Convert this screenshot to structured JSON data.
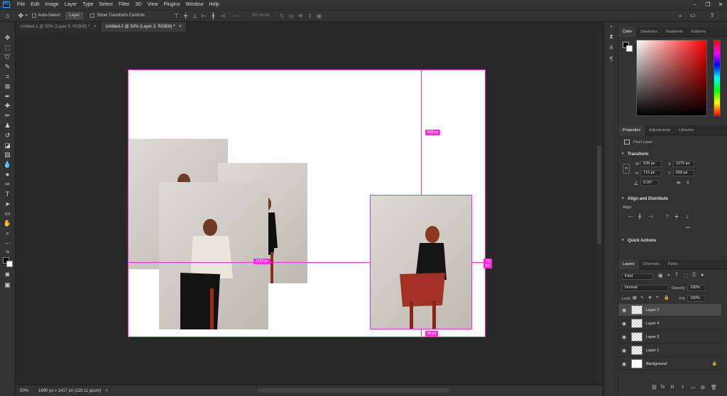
{
  "menubar": {
    "app_icon": "Ps",
    "items": [
      "File",
      "Edit",
      "Image",
      "Layer",
      "Type",
      "Select",
      "Filter",
      "3D",
      "View",
      "Plugins",
      "Window",
      "Help"
    ]
  },
  "options": {
    "auto_select_label": "Auto-Select:",
    "auto_select_value": "Layer",
    "show_transform_label": "Show Transform Controls",
    "mode_label": "3D Mode:"
  },
  "tabs": [
    {
      "label": "Untitled-1 @ 50% (Layer 5, RGB/8) *",
      "close": "×"
    },
    {
      "label": "Untitled-2 @ 50% (Layer 2, RGB/8) *",
      "close": "×"
    }
  ],
  "canvas": {
    "measure_top": "658 px",
    "measure_left": "1275 px",
    "measure_right": "70 px",
    "measure_bottom": "46 px",
    "accent_color": "#ff2bd6"
  },
  "status": {
    "zoom": "50%",
    "doc_info": "1890 px x 1417 px (118.11 ppcm)",
    "arrow": ">"
  },
  "color_panel": {
    "tabs": [
      "Color",
      "Swatches",
      "Gradients",
      "Patterns"
    ]
  },
  "properties": {
    "tabs": [
      "Properties",
      "Adjustments",
      "Libraries"
    ],
    "kind": "Pixel Layer",
    "transform_title": "Transform",
    "w_label": "W",
    "w_value": "539 px",
    "h_label": "H",
    "h_value": "715 px",
    "x_label": "X",
    "x_value": "1275 px",
    "y_label": "Y",
    "y_value": "658 px",
    "angle_value": "0.00°",
    "align_title": "Align and Distribute",
    "align_label": "Align:",
    "more": "•••",
    "quick_title": "Quick Actions"
  },
  "layers_panel": {
    "tabs": [
      "Layers",
      "Channels",
      "Paths"
    ],
    "kind_filter": "Kind",
    "blend_mode": "Normal",
    "opacity_label": "Opacity:",
    "opacity_value": "100%",
    "lock_label": "Lock:",
    "fill_label": "Fill:",
    "fill_value": "100%",
    "layers": [
      {
        "name": "Layer 2",
        "selected": true
      },
      {
        "name": "Layer 4",
        "selected": false
      },
      {
        "name": "Layer 3",
        "selected": false
      },
      {
        "name": "Layer 1",
        "selected": false
      },
      {
        "name": "Background",
        "selected": false
      }
    ]
  }
}
